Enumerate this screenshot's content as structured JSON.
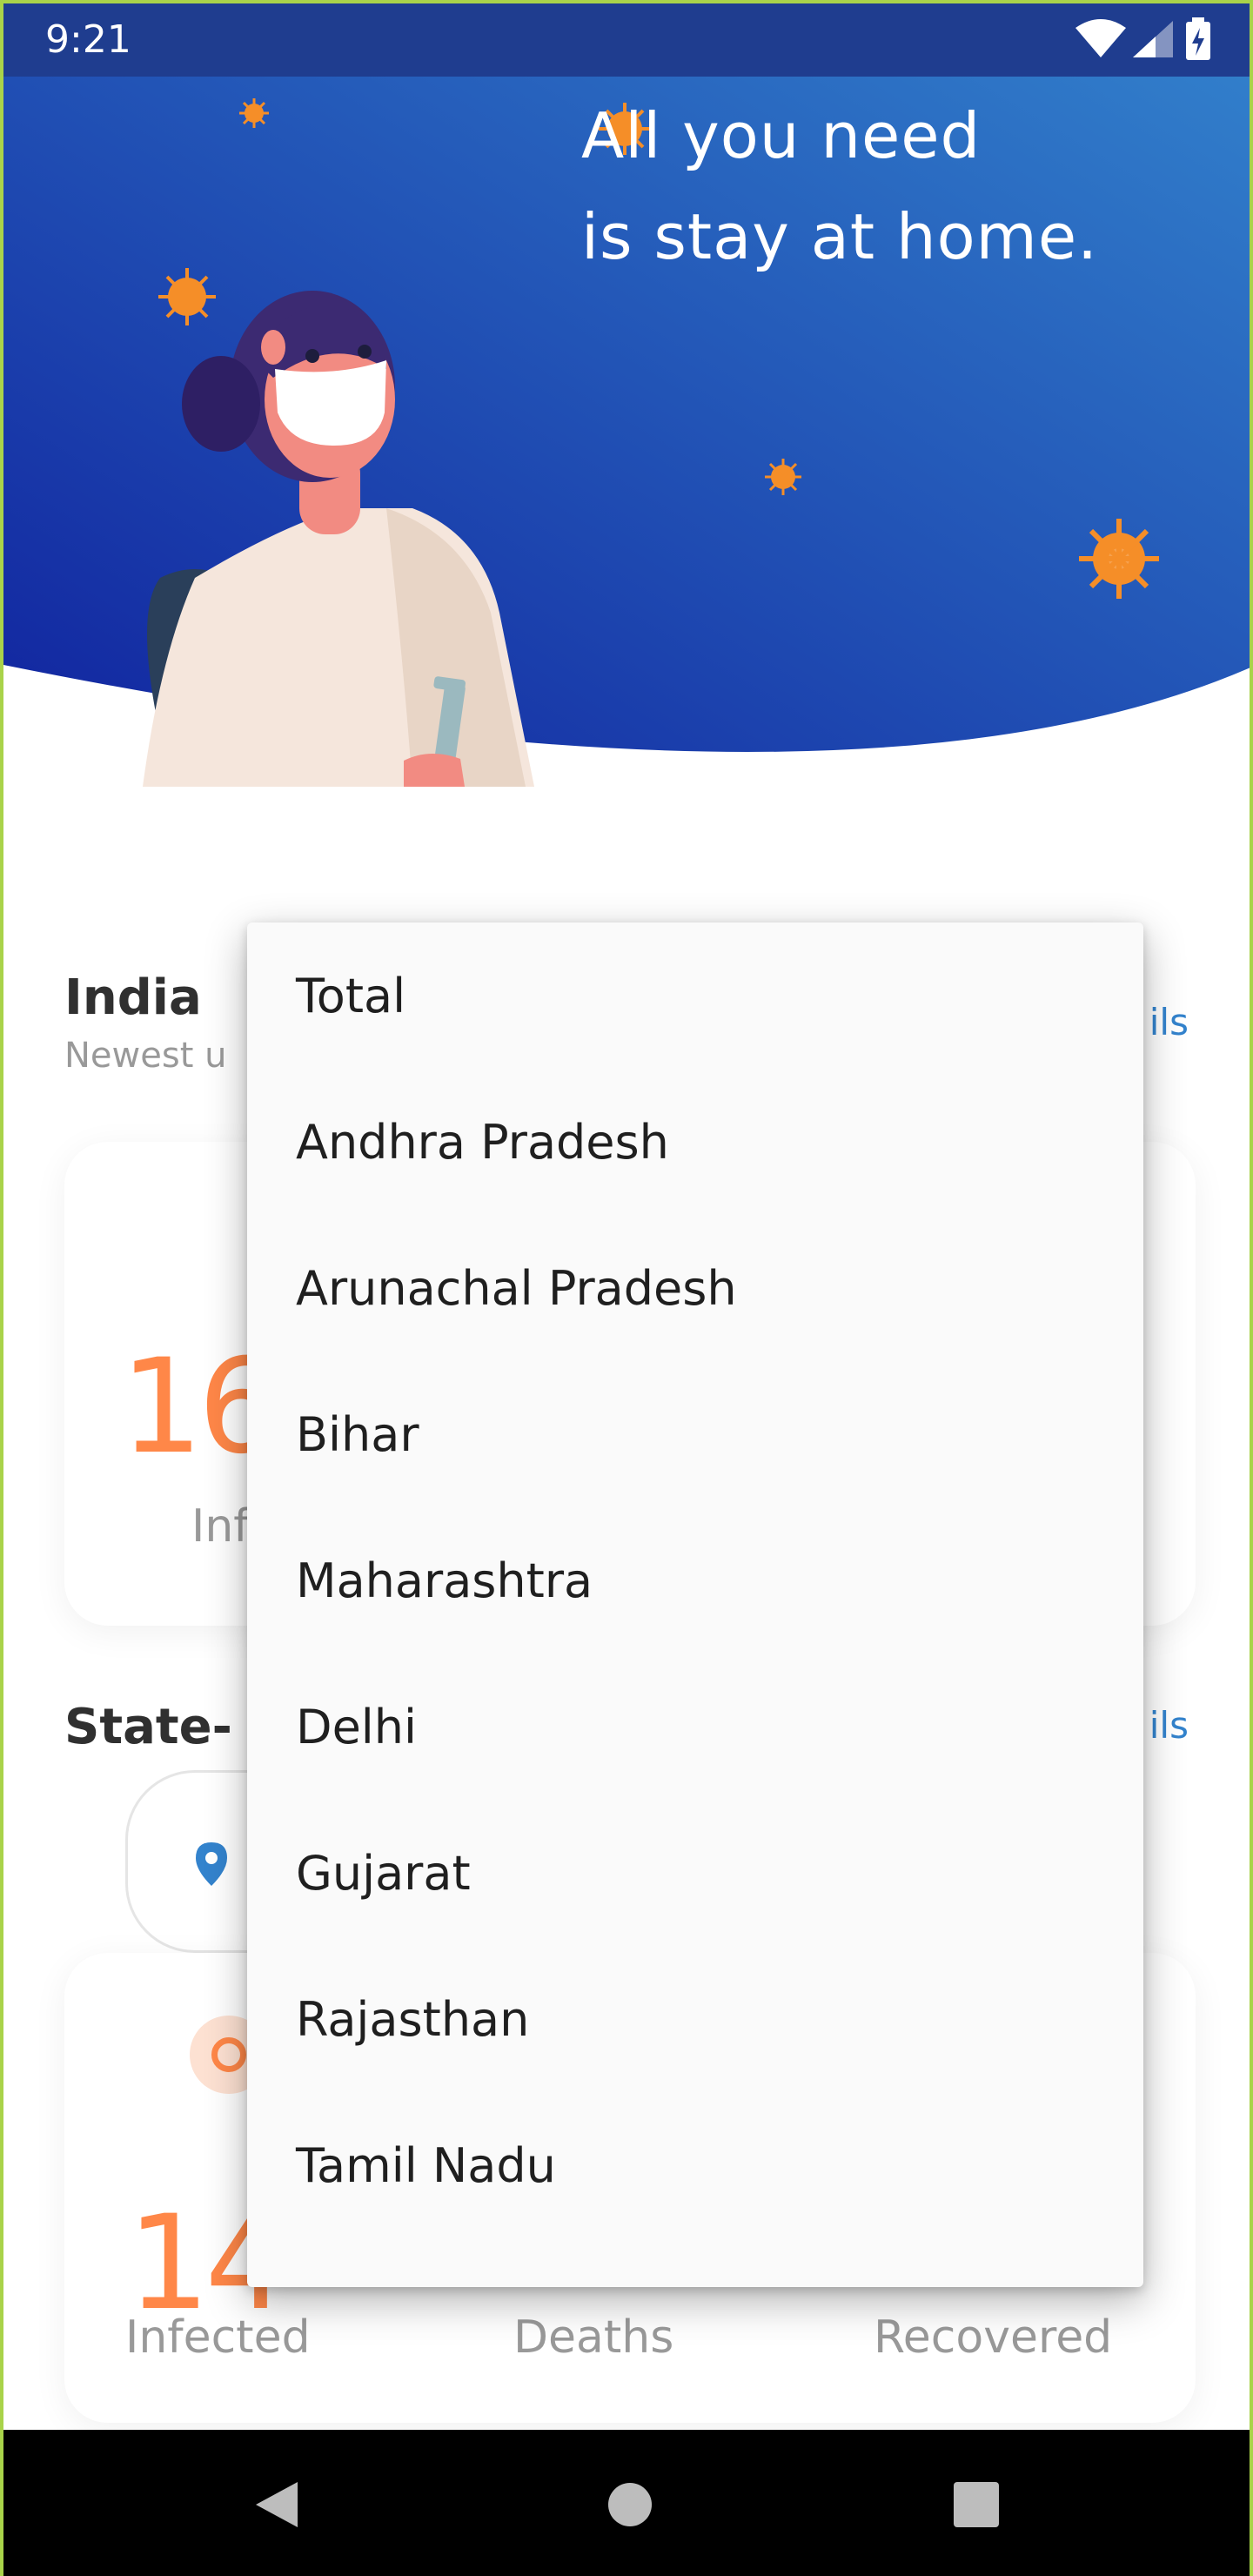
{
  "status_bar": {
    "time": "9:21",
    "icons": [
      "wifi-icon",
      "cell-signal-icon",
      "battery-charging-icon"
    ]
  },
  "header": {
    "headline_line1": "All you need",
    "headline_line2": "is stay at home.",
    "colors": {
      "gradient_start": "#3383cd",
      "gradient_end": "#11249f",
      "virus": "#f58e28"
    }
  },
  "india_section": {
    "title": "India",
    "subtitle": "Newest u",
    "details_link": "ils"
  },
  "india_card": {
    "infected_value": "16",
    "infected_label": "Inf"
  },
  "state_section": {
    "title": "State-",
    "details_link": "ils",
    "selector_icon": "location-pin-icon"
  },
  "state_card": {
    "infected_value": "14",
    "labels": {
      "infected": "Infected",
      "deaths": "Deaths",
      "recovered": "Recovered"
    }
  },
  "dropdown": {
    "items": [
      "Total",
      "Andhra Pradesh",
      "Arunachal Pradesh",
      "Bihar",
      "Maharashtra",
      "Delhi",
      "Gujarat",
      "Rajasthan",
      "Tamil Nadu"
    ]
  },
  "colors": {
    "accent_blue": "#3383cd",
    "infected_orange": "#ff8748",
    "text_dark": "#303030",
    "text_grey": "#999999"
  }
}
